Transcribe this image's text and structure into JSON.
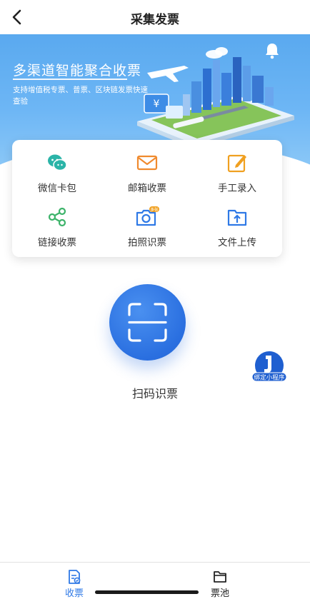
{
  "header": {
    "title": "采集发票",
    "back_icon": "chevron-left-icon"
  },
  "banner": {
    "headline": "多渠道智能聚合收票",
    "subtitle": "支持增值税专票、普票、区块链发票快速查验",
    "bell_icon": "bell-icon",
    "accent": "#5aa9ef"
  },
  "methods": [
    {
      "label": "微信卡包",
      "icon": "wechat-icon",
      "color": "#2bb4a8"
    },
    {
      "label": "邮箱收票",
      "icon": "mail-icon",
      "color": "#f08a2e"
    },
    {
      "label": "手工录入",
      "icon": "edit-icon",
      "color": "#f0a020"
    },
    {
      "label": "链接收票",
      "icon": "share-link-icon",
      "color": "#3db36a"
    },
    {
      "label": "拍照识票",
      "icon": "camera-icon",
      "color": "#2f79e6",
      "badge": "多张"
    },
    {
      "label": "文件上传",
      "icon": "folder-upload-icon",
      "color": "#2f79e6"
    }
  ],
  "scan": {
    "label": "扫码识票",
    "icon": "scan-icon",
    "color": "#2a6fe0"
  },
  "mini_program": {
    "label": "绑定小程序"
  },
  "tabs": [
    {
      "label": "收票",
      "icon": "receipt-icon",
      "active": true,
      "color": "#2f79e6"
    },
    {
      "label": "票池",
      "icon": "folder-icon",
      "active": false,
      "color": "#222222"
    }
  ]
}
